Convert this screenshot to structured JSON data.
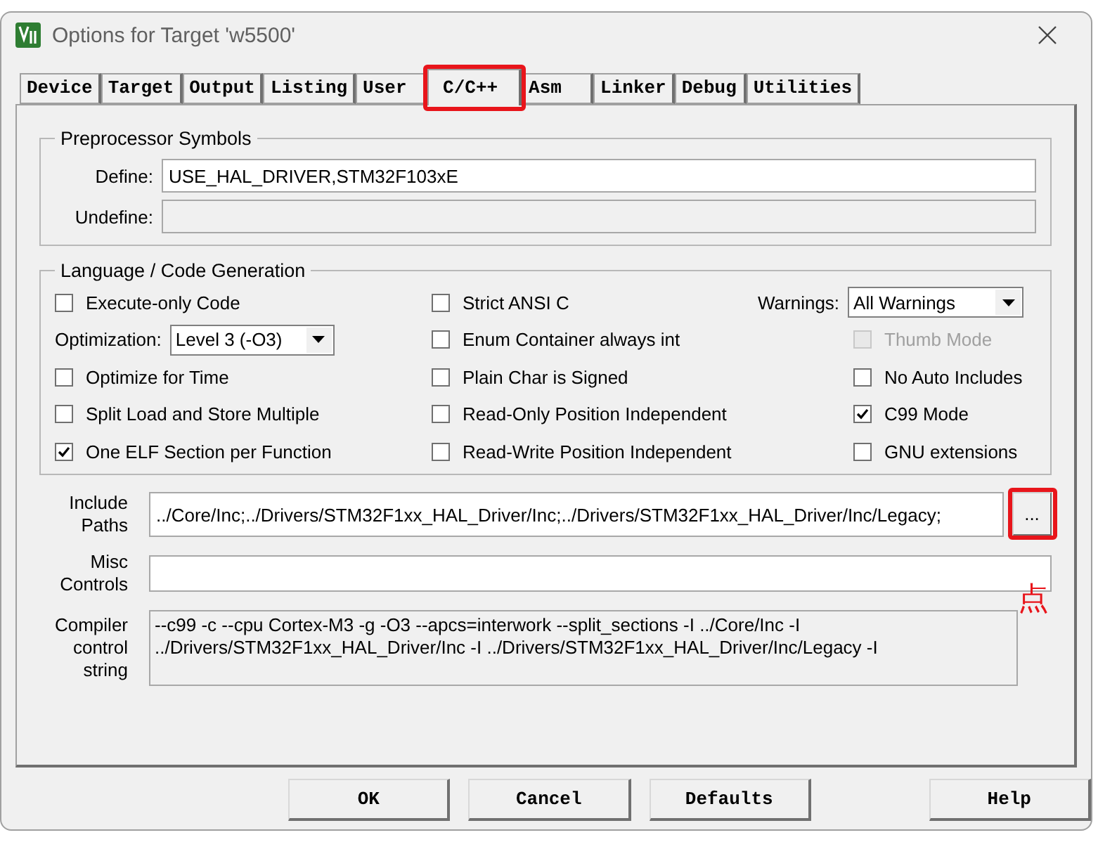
{
  "window": {
    "title": "Options for Target 'w5500'"
  },
  "tabs": [
    {
      "label": "Device",
      "selected": false,
      "highlighted": false
    },
    {
      "label": "Target",
      "selected": false,
      "highlighted": false
    },
    {
      "label": "Output",
      "selected": false,
      "highlighted": false
    },
    {
      "label": "Listing",
      "selected": false,
      "highlighted": false
    },
    {
      "label": "User",
      "selected": false,
      "highlighted": false
    },
    {
      "label": "C/C++",
      "selected": true,
      "highlighted": true
    },
    {
      "label": "Asm",
      "selected": false,
      "highlighted": false
    },
    {
      "label": "Linker",
      "selected": false,
      "highlighted": false
    },
    {
      "label": "Debug",
      "selected": false,
      "highlighted": false
    },
    {
      "label": "Utilities",
      "selected": false,
      "highlighted": false
    }
  ],
  "preprocessor": {
    "title": "Preprocessor Symbols",
    "fields": [
      {
        "label": "Define:",
        "value": "USE_HAL_DRIVER,STM32F103xE",
        "disabled": false
      },
      {
        "label": "Undefine:",
        "disabled": true
      }
    ]
  },
  "language": {
    "title": "Language / Code Generation",
    "columns": [
      [
        {
          "kind": "checkbox",
          "label": "Execute-only Code",
          "checked": false,
          "disabled": false
        },
        {
          "kind": "select",
          "label": "Optimization:",
          "value": "Level 3 (-O3)"
        },
        {
          "kind": "checkbox",
          "label": "Optimize for Time",
          "checked": false,
          "disabled": false
        },
        {
          "kind": "checkbox",
          "label": "Split Load and Store Multiple",
          "checked": false,
          "disabled": false
        },
        {
          "kind": "checkbox",
          "label": "One ELF Section per Function",
          "checked": true,
          "disabled": false
        }
      ],
      [
        {
          "kind": "checkbox",
          "label": "Strict ANSI C",
          "checked": false,
          "disabled": false
        },
        {
          "kind": "checkbox",
          "label": "Enum Container always int",
          "checked": false,
          "disabled": false
        },
        {
          "kind": "checkbox",
          "label": "Plain Char is Signed",
          "checked": false,
          "disabled": false
        },
        {
          "kind": "checkbox",
          "label": "Read-Only Position Independent",
          "checked": false,
          "disabled": false
        },
        {
          "kind": "checkbox",
          "label": "Read-Write Position Independent",
          "checked": false,
          "disabled": false
        }
      ],
      [
        {
          "kind": "select",
          "label": "Warnings:",
          "value": "All Warnings"
        },
        {
          "kind": "checkbox",
          "label": "Thumb Mode",
          "checked": false,
          "disabled": true
        },
        {
          "kind": "checkbox",
          "label": "No Auto Includes",
          "checked": false,
          "disabled": false
        },
        {
          "kind": "checkbox",
          "label": "C99 Mode",
          "checked": true,
          "disabled": false
        },
        {
          "kind": "checkbox",
          "label": "GNU extensions",
          "checked": false,
          "disabled": false
        }
      ]
    ]
  },
  "paths": [
    {
      "kind": "field",
      "label": "Include Paths",
      "value": "../Core/Inc;../Drivers/STM32F1xx_HAL_Driver/Inc;../Drivers/STM32F1xx_HAL_Driver/Inc/Legacy;",
      "browse": {
        "label": "...",
        "highlighted": true
      }
    },
    {
      "kind": "field",
      "label": "Misc Controls",
      "note": "点"
    },
    {
      "kind": "readonly",
      "label": "Compiler control string",
      "lines": [
        "--c99 -c --cpu Cortex-M3 -g -O3 --apcs=interwork --split_sections -I ../Core/Inc -I",
        "../Drivers/STM32F1xx_HAL_Driver/Inc -I ../Drivers/STM32F1xx_HAL_Driver/Inc/Legacy -I"
      ]
    }
  ],
  "buttons": [
    {
      "label": "OK"
    },
    {
      "label": "Cancel"
    },
    {
      "label": "Defaults"
    },
    {
      "label": "Help"
    }
  ]
}
